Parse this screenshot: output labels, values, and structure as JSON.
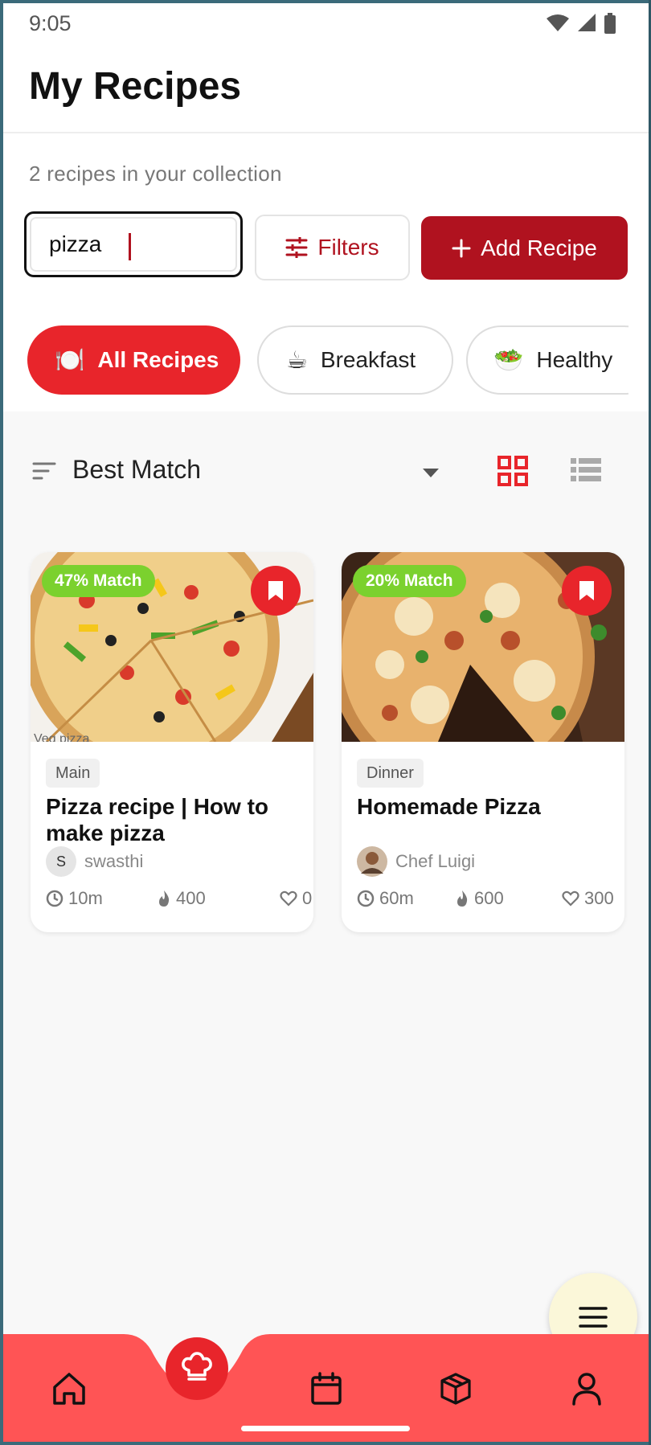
{
  "status_bar": {
    "time": "9:05",
    "icons": [
      "wifi-icon",
      "signal-icon",
      "battery-icon"
    ]
  },
  "header": {
    "title": "My Recipes"
  },
  "summary": {
    "subtitle": "2 recipes in your collection"
  },
  "search": {
    "value": "pizza"
  },
  "toolbar": {
    "filters_label": "Filters",
    "add_label": "Add Recipe"
  },
  "categories": [
    {
      "emoji": "🍽️",
      "label": "All Recipes",
      "active": true
    },
    {
      "emoji": "☕",
      "label": "Breakfast",
      "active": false
    },
    {
      "emoji": "🥗",
      "label": "Healthy",
      "active": false
    }
  ],
  "sort": {
    "label": "Best Match",
    "view_modes": [
      "grid-view",
      "list-view"
    ],
    "active_view": "grid-view"
  },
  "recipes": [
    {
      "match": "47% Match",
      "category": "Main",
      "title": "Pizza recipe | How to make pizza",
      "author": "swasthi",
      "author_initial": "S",
      "time": "10m",
      "calories": "400",
      "likes": "0",
      "image_caption": "Veg pizza"
    },
    {
      "match": "20% Match",
      "category": "Dinner",
      "title": "Homemade Pizza",
      "author": "Chef Luigi",
      "time": "60m",
      "calories": "600",
      "likes": "300"
    }
  ],
  "bottom_nav": [
    "home-icon",
    "chef-hat-icon",
    "calendar-icon",
    "box-icon",
    "profile-icon"
  ],
  "colors": {
    "brand": "#b0121f",
    "accent": "#e8252b",
    "match_badge": "#7bd12e",
    "nav_bar": "#ff5455",
    "fab": "#fbf7d9"
  }
}
